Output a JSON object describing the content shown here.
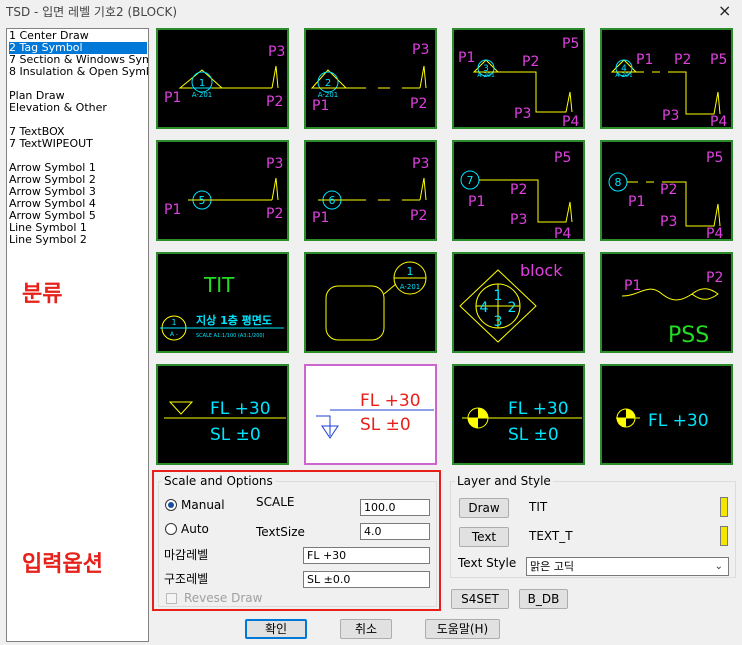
{
  "window": {
    "title": "TSD - 입면 레벨 기호2 (BLOCK)",
    "close_glyph": "×"
  },
  "categories": {
    "items": [
      {
        "label": "1 Center Draw",
        "selected": false
      },
      {
        "label": "2 Tag Symbol",
        "selected": true
      },
      {
        "label": "7 Section & Windows Symbol",
        "selected": false
      },
      {
        "label": "8 Insulation & Open Symbol",
        "selected": false
      },
      {
        "label": "",
        "selected": false
      },
      {
        "label": "Plan Draw",
        "selected": false
      },
      {
        "label": "Elevation & Other",
        "selected": false
      },
      {
        "label": "",
        "selected": false
      },
      {
        "label": "7 TextBOX",
        "selected": false
      },
      {
        "label": "7 TextWIPEOUT",
        "selected": false
      },
      {
        "label": "",
        "selected": false
      },
      {
        "label": "Arrow Symbol 1",
        "selected": false
      },
      {
        "label": "Arrow Symbol 2",
        "selected": false
      },
      {
        "label": "Arrow Symbol 3",
        "selected": false
      },
      {
        "label": "Arrow Symbol 4",
        "selected": false
      },
      {
        "label": "Arrow Symbol 5",
        "selected": false
      },
      {
        "label": "Line Symbol 1",
        "selected": false
      },
      {
        "label": "Line Symbol 2",
        "selected": false
      }
    ]
  },
  "annotations": {
    "category_label": "분류",
    "options_label": "입력옵션"
  },
  "tiles": {
    "p1": "P1",
    "p2": "P2",
    "p3": "P3",
    "p4": "P4",
    "p5": "P5",
    "a201": "A-201",
    "n1": "1",
    "n2": "2",
    "n3": "3",
    "n4": "4",
    "n5": "5",
    "n6": "6",
    "n7": "7",
    "n8": "8",
    "tit": "TIT",
    "title_kr": "지상 1층 평면도",
    "scale_txt": "SCALE A1:1/100 (A3:1/200)",
    "tit_num": "1",
    "tit_sub": "A -",
    "block": "block",
    "pss": "PSS",
    "fl": "FL +30",
    "sl": "SL ±0"
  },
  "scale_options": {
    "title": "Scale and Options",
    "manual_label": "Manual",
    "auto_label": "Auto",
    "manual_selected": true,
    "scale_label": "SCALE",
    "scale_value": "100.0",
    "textsize_label": "TextSize",
    "textsize_value": "4.0",
    "finish_level_label": "마감레벨",
    "finish_level_value": "FL +30",
    "struct_level_label": "구조레벨",
    "struct_level_value": "SL ±0.0",
    "reverse_draw_label": "Revese Draw"
  },
  "layer_style": {
    "title": "Layer and Style",
    "draw_button": "Draw",
    "draw_layer": "TIT",
    "text_button": "Text",
    "text_layer": "TEXT_T",
    "text_style_label": "Text Style",
    "text_style_value": "맑은 고딕",
    "layer_color": "#f5e600"
  },
  "buttons": {
    "s4set": "S4SET",
    "b_db": "B_DB",
    "ok": "확인",
    "cancel": "취소",
    "help": "도움말(H)"
  },
  "colors": {
    "magenta": "#e040e0",
    "cyan": "#00e5ff",
    "yellow": "#ffff00",
    "green": "#22dd22",
    "red": "#e8201a",
    "tile_border": "#2b8c2b"
  }
}
